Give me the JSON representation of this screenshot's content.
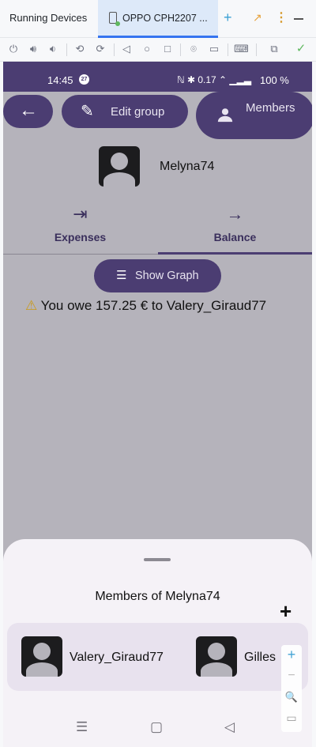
{
  "ide": {
    "title": "Running Devices",
    "tab_label": "OPPO CPH2207 ...",
    "plus": "+",
    "arrow": "↗",
    "menu": "⋮"
  },
  "toolbar": {
    "icons": [
      "power-icon",
      "volume-up-icon",
      "volume-down-icon",
      "rotate-left-icon",
      "rotate-right-icon",
      "back-icon",
      "home-icon",
      "overview-icon",
      "screenshot-icon",
      "record-icon",
      "keyboard-icon",
      "zoom-window-icon",
      "check-icon"
    ]
  },
  "status_bar": {
    "time": "14:45",
    "badge": "27",
    "network": "ℕ ✱ 0.17 ⌃ ▁▂▃",
    "battery": "100 %"
  },
  "header": {
    "edit_label": "Edit group",
    "members_label": "Members"
  },
  "group": {
    "name": "Melyna74"
  },
  "tabs": [
    {
      "label": "Expenses",
      "icon": "⇥"
    },
    {
      "label": "Balance",
      "icon": "→"
    }
  ],
  "balance": {
    "show_graph_label": "Show Graph",
    "warning_icon": "⚠",
    "owe_text": "You owe 157.25 € to Valery_Giraud77"
  },
  "sheet": {
    "title": "Members of Melyna74",
    "add": "+",
    "members": [
      {
        "name": "Valery_Giraud77"
      },
      {
        "name": "Gilles"
      }
    ]
  },
  "zoom": {
    "plus": "+",
    "minus": "−",
    "search": "🔍",
    "fit": "▭"
  },
  "colors": {
    "primary": "#4b3d72",
    "scrim_background": "#b5b3bb",
    "sheet": "#f5f2f7"
  }
}
